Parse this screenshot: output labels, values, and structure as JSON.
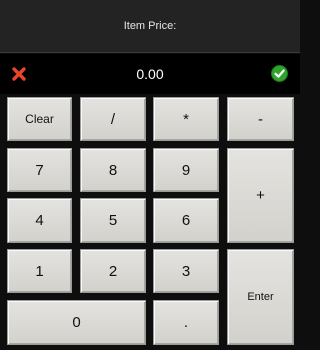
{
  "header": {
    "title": "Item Price:"
  },
  "display": {
    "value": "0.00",
    "cancel_icon": "red-x-icon",
    "accept_icon": "green-check-icon",
    "colors": {
      "cancel": "#e8452c",
      "accept": "#2fa52f"
    }
  },
  "keys": {
    "clear": "Clear",
    "divide": "/",
    "multiply": "*",
    "minus": "-",
    "seven": "7",
    "eight": "8",
    "nine": "9",
    "plus": "+",
    "four": "4",
    "five": "5",
    "six": "6",
    "one": "1",
    "two": "2",
    "three": "3",
    "enter": "Enter",
    "zero": "0",
    "decimal": "."
  }
}
